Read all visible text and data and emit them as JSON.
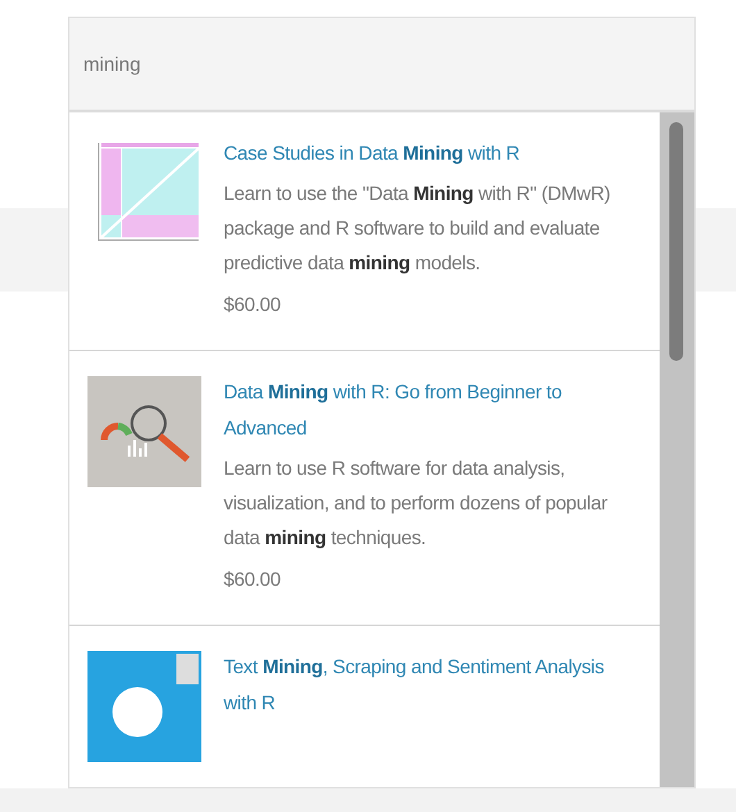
{
  "search": {
    "value": "mining"
  },
  "results": [
    {
      "kind": "chart",
      "title": "Case Studies in Data **Mining** with R",
      "description": "Learn to use the \"Data **Mining** with R\" (DMwR) package and R software to build and evaluate predictive data **mining** models.",
      "price": "$60.00"
    },
    {
      "kind": "magnifier",
      "title": "Data **Mining** with R: Go from Beginner to Advanced",
      "description": "Learn to use R software for data analysis, visualization, and to perform dozens of popular data **mining** techniques.",
      "price": "$60.00"
    },
    {
      "kind": "bird",
      "title": "Text **Mining**, Scraping and Sentiment Analysis with R"
    }
  ]
}
